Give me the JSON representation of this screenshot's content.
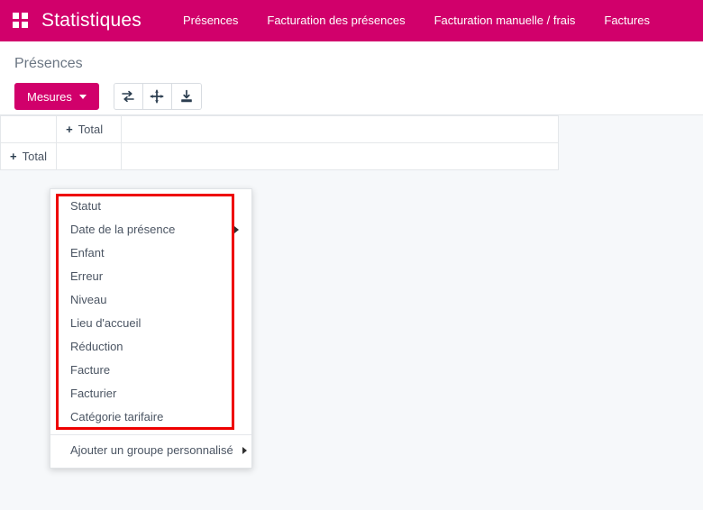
{
  "navbar": {
    "apps_icon": "apps-grid-icon",
    "brand": "Statistiques",
    "links": [
      {
        "label": "Présences"
      },
      {
        "label": "Facturation des présences"
      },
      {
        "label": "Facturation manuelle / frais"
      },
      {
        "label": "Factures"
      }
    ],
    "background_color": "#d1006b"
  },
  "control_panel": {
    "breadcrumb": "Présences",
    "measures_button": "Mesures",
    "measures_caret": "caret-down-icon",
    "tools": [
      {
        "name": "flip-axis-icon",
        "title": "Inverser les axes"
      },
      {
        "name": "expand-all-icon",
        "title": "Tout déplier"
      },
      {
        "name": "download-xlsx-icon",
        "title": "Télécharger xlsx"
      }
    ]
  },
  "pivot": {
    "corner_label": "",
    "column_header": {
      "plus": "+",
      "label": "Total"
    },
    "row_header": {
      "plus": "+",
      "label": "Total"
    }
  },
  "dropdown": {
    "items": [
      {
        "label": "Statut",
        "has_submenu": false
      },
      {
        "label": "Date de la présence",
        "has_submenu": true
      },
      {
        "label": "Enfant",
        "has_submenu": false
      },
      {
        "label": "Erreur",
        "has_submenu": false
      },
      {
        "label": "Niveau",
        "has_submenu": false
      },
      {
        "label": "Lieu d'accueil",
        "has_submenu": false
      },
      {
        "label": "Réduction",
        "has_submenu": false
      },
      {
        "label": "Facture",
        "has_submenu": false
      },
      {
        "label": "Facturier",
        "has_submenu": false
      },
      {
        "label": "Catégorie tarifaire",
        "has_submenu": false
      }
    ],
    "footer_item": {
      "label": "Ajouter un groupe personnalisé",
      "has_submenu": true
    }
  },
  "annotation": {
    "highlight_color": "#ee0000",
    "highlight_target": "group-by-field-list"
  }
}
